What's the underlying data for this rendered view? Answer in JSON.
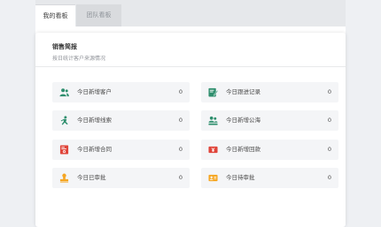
{
  "tabs": [
    {
      "label": "我的看板"
    },
    {
      "label": "团队看板"
    }
  ],
  "card": {
    "title": "销售简报",
    "subtitle": "按日统计客户来源情况"
  },
  "stats": [
    {
      "label": "今日新增客户",
      "value": "0",
      "icon": "customers-icon",
      "color": "#2f8f6e"
    },
    {
      "label": "今日跟进记录",
      "value": "0",
      "icon": "follow-up-icon",
      "color": "#2f8f6e"
    },
    {
      "label": "今日新增线索",
      "value": "0",
      "icon": "leads-icon",
      "color": "#2f8f6e"
    },
    {
      "label": "今日新增公海",
      "value": "0",
      "icon": "public-pool-icon",
      "color": "#2f8f6e"
    },
    {
      "label": "今日新增合同",
      "value": "0",
      "icon": "contract-icon",
      "color": "#e0453a"
    },
    {
      "label": "今日新增回款",
      "value": "0",
      "icon": "payment-icon",
      "color": "#e0453a"
    },
    {
      "label": "今日已审批",
      "value": "0",
      "icon": "approved-icon",
      "color": "#f5a623"
    },
    {
      "label": "今日待审批",
      "value": "0",
      "icon": "pending-approval-icon",
      "color": "#f5a623"
    }
  ]
}
